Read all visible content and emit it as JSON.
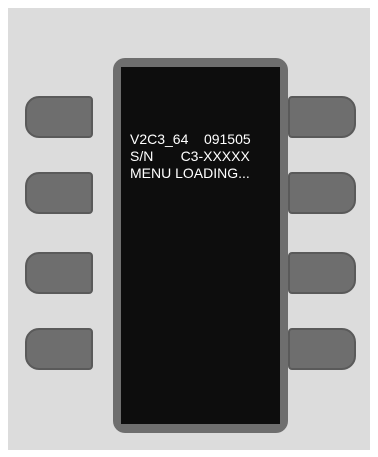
{
  "device": {
    "screen": {
      "lines": [
        "V2C3_64    091505",
        "S/N       C3-XXXXX",
        "MENU LOADING..."
      ]
    },
    "soft_keys": {
      "left": [
        "left-soft-key-1",
        "left-soft-key-2",
        "left-soft-key-3",
        "left-soft-key-4"
      ],
      "right": [
        "right-soft-key-1",
        "right-soft-key-2",
        "right-soft-key-3",
        "right-soft-key-4"
      ]
    }
  },
  "colors": {
    "panel": "#dcdcdc",
    "bezel": "#6e6e6e",
    "screen": "#0d0d0d",
    "text": "#ffffff"
  }
}
